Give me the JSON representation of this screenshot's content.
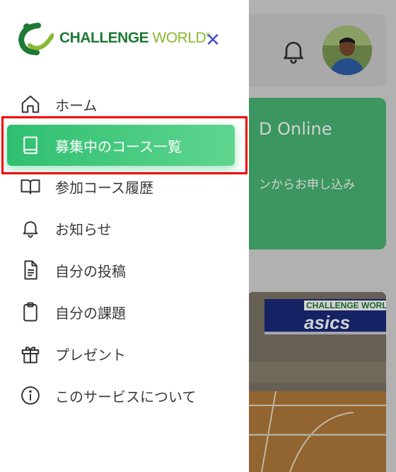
{
  "app": {
    "logo_main": "CHALLENGE",
    "logo_world": " WORLD",
    "logo_mark": "®"
  },
  "drawer": {
    "close_label": "✕",
    "items": [
      {
        "label": "ホーム",
        "icon": "home-icon"
      },
      {
        "label": "募集中のコース一覧",
        "icon": "book-icon",
        "active": true
      },
      {
        "label": "参加コース履歴",
        "icon": "open-book-icon"
      },
      {
        "label": "お知らせ",
        "icon": "bell-icon"
      },
      {
        "label": "自分の投稿",
        "icon": "document-icon"
      },
      {
        "label": "自分の課題",
        "icon": "clipboard-icon"
      },
      {
        "label": "プレゼント",
        "icon": "gift-icon"
      },
      {
        "label": "このサービスについて",
        "icon": "info-icon"
      }
    ]
  },
  "background": {
    "course_title": "D Online",
    "course_sub": "ンからお申し込み",
    "banner_brand": "CHALLENGE WORLD",
    "banner_asics": "asics"
  },
  "colors": {
    "accent_green": "#2fbf71",
    "logo_green": "#1f7a36",
    "close_blue": "#4b50c8",
    "highlight_red": "#e00000"
  }
}
